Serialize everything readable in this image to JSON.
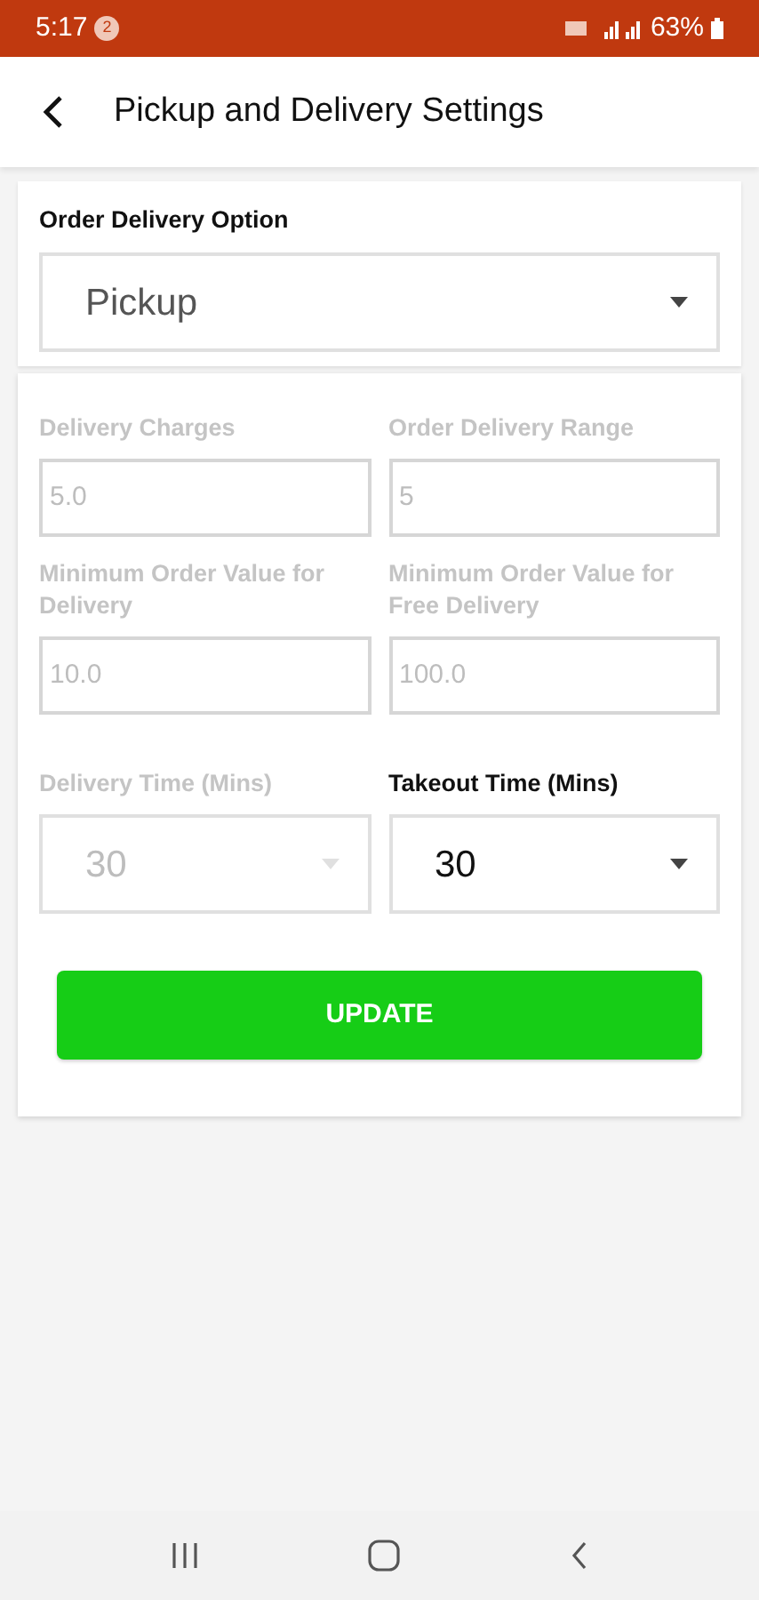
{
  "status_bar": {
    "time": "5:17",
    "notification_count": "2",
    "battery": "63%"
  },
  "header": {
    "title": "Pickup and Delivery Settings"
  },
  "delivery_option": {
    "label": "Order Delivery Option",
    "value": "Pickup"
  },
  "fields": [
    {
      "kind": "input",
      "label": "Delivery Charges",
      "value": "5.0",
      "disabled": true
    },
    {
      "kind": "input",
      "label": "Order Delivery Range",
      "value": "5",
      "disabled": true
    },
    {
      "kind": "input",
      "label": "Minimum Order Value for Delivery",
      "value": "10.0",
      "disabled": true
    },
    {
      "kind": "input",
      "label": "Minimum Order Value for Free Delivery",
      "value": "100.0",
      "disabled": true
    },
    {
      "kind": "select",
      "label": "Delivery Time (Mins)",
      "value": "30",
      "disabled": true
    },
    {
      "kind": "select",
      "label": "Takeout Time (Mins)",
      "value": "30",
      "disabled": false
    }
  ],
  "button": "UPDATE"
}
